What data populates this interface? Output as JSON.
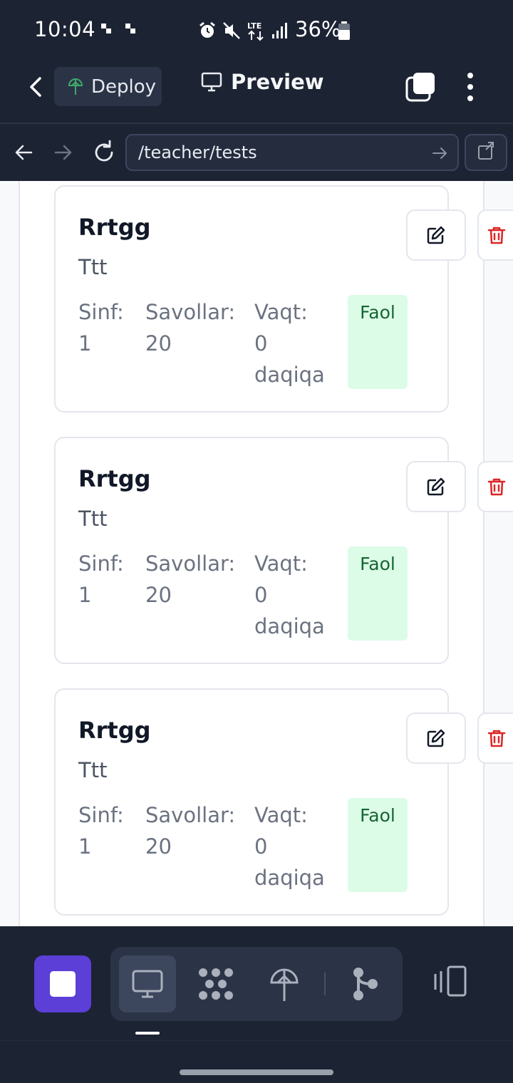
{
  "status_bar": {
    "time": "10:04",
    "battery": "36%"
  },
  "app_bar": {
    "deploy_label": "Deploy",
    "preview_label": "Preview"
  },
  "url_bar": {
    "url": "/teacher/tests"
  },
  "tests": [
    {
      "title": "Rrtgg",
      "description": "Ttt",
      "class_label": "Sinf:",
      "class_value": "1",
      "questions_label": "Savollar:",
      "questions_value": "20",
      "time_label": "Vaqt:",
      "time_value": "0",
      "time_unit": "daqiqa",
      "status": "Faol"
    },
    {
      "title": "Rrtgg",
      "description": "Ttt",
      "class_label": "Sinf:",
      "class_value": "1",
      "questions_label": "Savollar:",
      "questions_value": "20",
      "time_label": "Vaqt:",
      "time_value": "0",
      "time_unit": "daqiqa",
      "status": "Faol"
    },
    {
      "title": "Rrtgg",
      "description": "Ttt",
      "class_label": "Sinf:",
      "class_value": "1",
      "questions_label": "Savollar:",
      "questions_value": "20",
      "time_label": "Vaqt:",
      "time_value": "0",
      "time_unit": "daqiqa",
      "status": "Faol"
    }
  ],
  "colors": {
    "accent": "#5b3fd6",
    "status_bg": "#dcfce7",
    "status_text": "#166534",
    "delete": "#dc2626"
  },
  "icons": {
    "status": [
      "alarm-icon",
      "mute-icon",
      "lte-icon",
      "signal-icon",
      "battery-icon"
    ],
    "toolbar": [
      "stop-icon",
      "desktop-icon",
      "workspace-icon",
      "deploy-icon",
      "git-icon",
      "devices-icon"
    ],
    "card_actions": [
      "edit-icon",
      "trash-icon"
    ]
  }
}
